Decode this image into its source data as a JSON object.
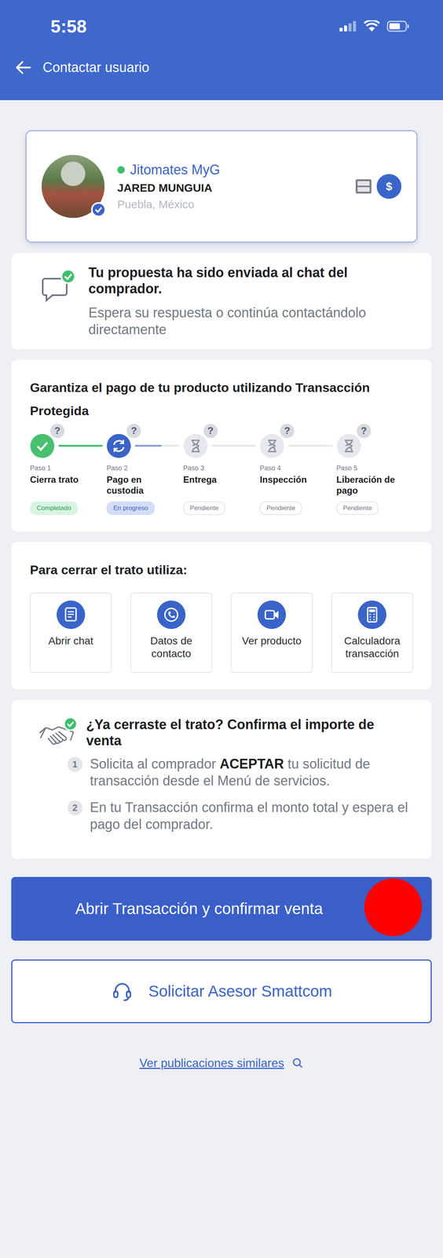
{
  "status_bar": {
    "time": "5:58"
  },
  "header": {
    "title": "Contactar usuario"
  },
  "profile": {
    "online": true,
    "verified": true,
    "store": "Jitomates MyG",
    "name": "JARED MUNGUIA",
    "location": "Puebla, México",
    "badge": "$"
  },
  "notice": {
    "title": "Tu propuesta ha sido enviada al chat del comprador.",
    "text": "Espera su respuesta o continúa contactándolo directamente"
  },
  "protected": {
    "title": "Garantiza el pago de tu producto utilizando Transacción Protegida",
    "help": "?",
    "steps": [
      {
        "step": "Paso 1",
        "label": "Cierra trato",
        "status": "Completado",
        "kind": "done"
      },
      {
        "step": "Paso 2",
        "label": "Pago en custodia",
        "status": "En progreso",
        "kind": "active"
      },
      {
        "step": "Paso 3",
        "label": "Entrega",
        "status": "Pendiente",
        "kind": "pending"
      },
      {
        "step": "Paso 4",
        "label": "Inspección",
        "status": "Pendiente",
        "kind": "pending"
      },
      {
        "step": "Paso 5",
        "label": "Liberación de pago",
        "status": "Pendiente",
        "kind": "pending"
      }
    ]
  },
  "tools": {
    "title": "Para cerrar el trato utiliza:",
    "items": [
      {
        "label": "Abrir chat",
        "kind": "chat"
      },
      {
        "label": "Datos de contacto",
        "kind": "phone"
      },
      {
        "label": "Ver producto",
        "kind": "video"
      },
      {
        "label": "Calculadora transacción",
        "kind": "calc"
      }
    ]
  },
  "confirm": {
    "title": "¿Ya cerraste el trato? Confirma el importe de venta",
    "steps": [
      {
        "number": "1",
        "parts": [
          {
            "text": "Solicita al comprador ",
            "bold": false
          },
          {
            "text": "ACEPTAR",
            "bold": true
          },
          {
            "text": " tu solicitud de transacción desde el Menú de servicios.",
            "bold": false
          }
        ]
      },
      {
        "number": "2",
        "parts": [
          {
            "text": "En tu Transacción confirma el monto total y espera el pago del comprador.",
            "bold": false
          }
        ]
      }
    ]
  },
  "buttons": {
    "primary": "Abrir Transacción y confirmar venta",
    "secondary": "Solicitar Asesor Smattcom"
  },
  "link": "Ver publicaciones similares"
}
